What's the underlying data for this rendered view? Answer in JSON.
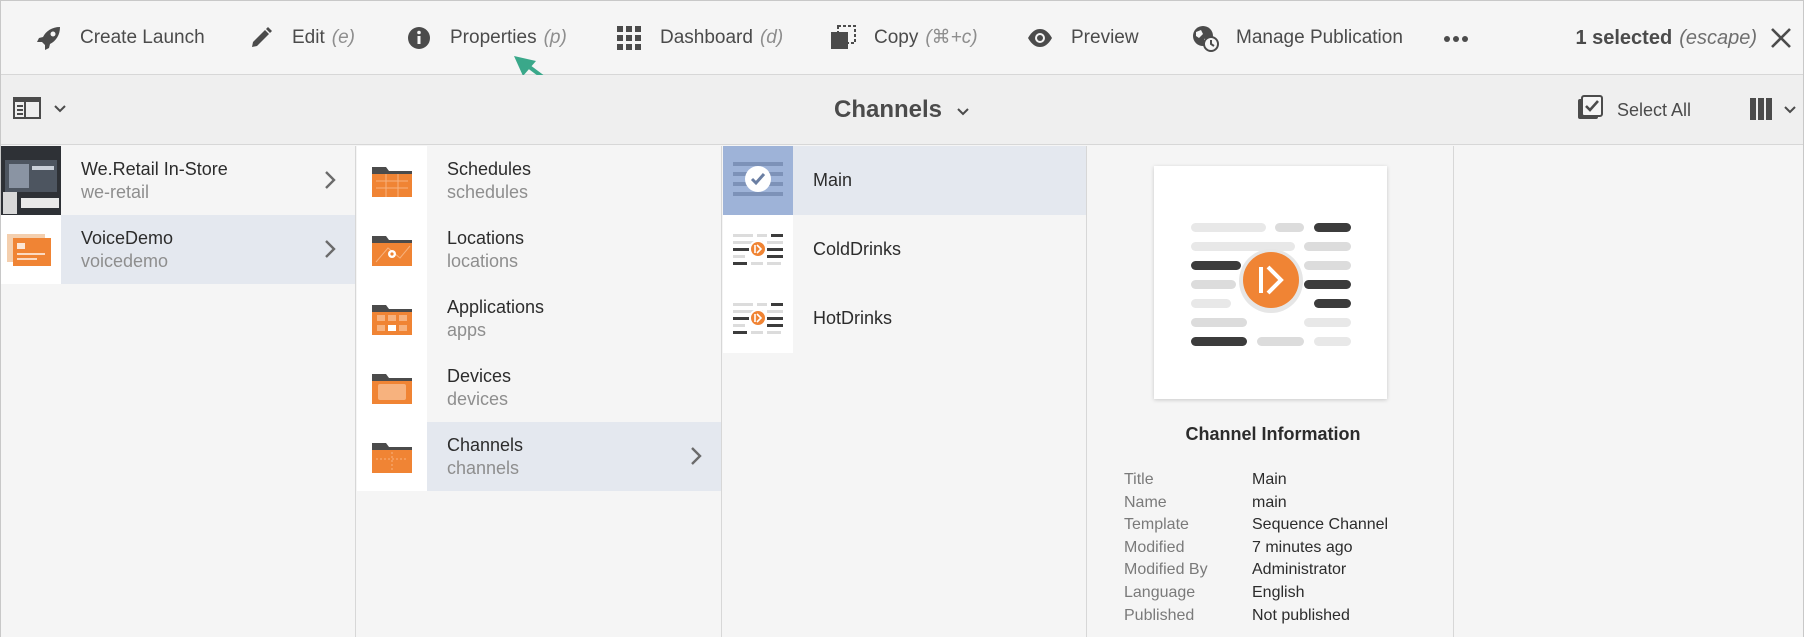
{
  "actionbar": {
    "actions": [
      {
        "label": "Create Launch",
        "shortcut": "",
        "icon": "rocket-icon"
      },
      {
        "label": "Edit",
        "shortcut": "(e)",
        "icon": "pencil-icon"
      },
      {
        "label": "Properties",
        "shortcut": "(p)",
        "icon": "info-icon"
      },
      {
        "label": "Dashboard",
        "shortcut": "(d)",
        "icon": "grid-icon"
      },
      {
        "label": "Copy",
        "shortcut": "(⌘+c)",
        "icon": "copy-icon"
      },
      {
        "label": "Preview",
        "shortcut": "",
        "icon": "eye-icon"
      },
      {
        "label": "Manage Publication",
        "shortcut": "",
        "icon": "globe-clock-icon"
      }
    ],
    "more_icon": "more-icon",
    "selected_count": "1 selected",
    "escape_hint": "(escape)",
    "close_icon": "close-icon"
  },
  "titlebar": {
    "title": "Channels",
    "select_all": "Select All"
  },
  "columns": {
    "sites": [
      {
        "title": "We.Retail In-Store",
        "name": "we-retail",
        "active": false
      },
      {
        "title": "VoiceDemo",
        "name": "voicedemo",
        "active": true
      }
    ],
    "folders": [
      {
        "title": "Schedules",
        "name": "schedules",
        "active": false
      },
      {
        "title": "Locations",
        "name": "locations",
        "active": false
      },
      {
        "title": "Applications",
        "name": "apps",
        "active": false
      },
      {
        "title": "Devices",
        "name": "devices",
        "active": false
      },
      {
        "title": "Channels",
        "name": "channels",
        "active": true
      }
    ],
    "channels": [
      {
        "title": "Main",
        "selected": true
      },
      {
        "title": "ColdDrinks",
        "selected": false
      },
      {
        "title": "HotDrinks",
        "selected": false
      }
    ]
  },
  "preview": {
    "heading": "Channel Information",
    "meta": [
      {
        "key": "Title",
        "value": "Main"
      },
      {
        "key": "Name",
        "value": "main"
      },
      {
        "key": "Template",
        "value": "Sequence Channel"
      },
      {
        "key": "Modified",
        "value": "7 minutes ago"
      },
      {
        "key": "Modified By",
        "value": "Administrator"
      },
      {
        "key": "Language",
        "value": "English"
      },
      {
        "key": "Published",
        "value": "Not published"
      }
    ]
  },
  "colors": {
    "accent_orange": "#f08434",
    "annotation_arrow": "#3aa88a",
    "selected_row": "#e4e8ef",
    "selected_thumb": "#9eb3d8"
  }
}
